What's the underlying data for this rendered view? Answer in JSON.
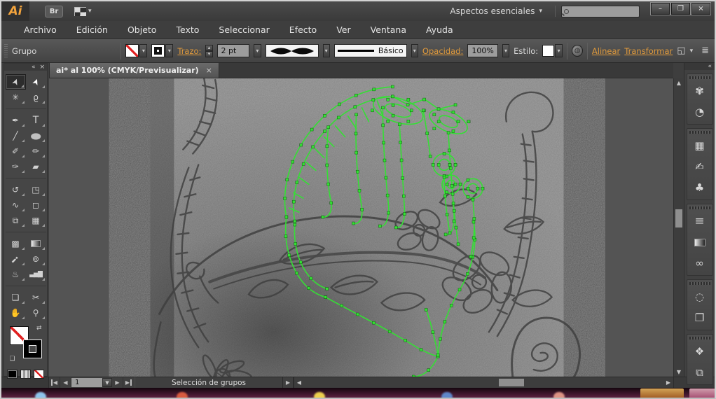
{
  "window": {
    "app_initials": "Ai",
    "bridge_label": "Br",
    "workspace_switcher": "Aspectos esenciales",
    "search_value": ""
  },
  "menus": [
    "Archivo",
    "Edición",
    "Objeto",
    "Texto",
    "Seleccionar",
    "Efecto",
    "Ver",
    "Ventana",
    "Ayuda"
  ],
  "control_bar": {
    "selection_label": "Grupo",
    "stroke_link": "Trazo:",
    "stroke_width_value": "2 pt",
    "brush_definition": "Básico",
    "opacity_link": "Opacidad:",
    "opacity_value": "100%",
    "style_label": "Estilo:",
    "align_link": "Alinear",
    "transform_link": "Transformar"
  },
  "tab": {
    "title": "ai* al 100% (CMYK/Previsualizar)",
    "close": "×"
  },
  "tools_panel": {
    "collapse": "«",
    "close": "×"
  },
  "tools": [
    {
      "name": "selection-tool",
      "glyph": "➤",
      "active": true
    },
    {
      "name": "direct-selection-tool",
      "glyph": "➤",
      "active": false
    },
    {
      "name": "magic-wand-tool",
      "glyph": "✳",
      "active": false
    },
    {
      "name": "lasso-tool",
      "glyph": "ϱ",
      "active": false
    },
    {
      "name": "pen-tool",
      "glyph": "✒",
      "active": false
    },
    {
      "name": "type-tool",
      "glyph": "T",
      "active": false
    },
    {
      "name": "line-segment-tool",
      "glyph": "╱",
      "active": false
    },
    {
      "name": "ellipse-tool",
      "glyph": "●",
      "active": false
    },
    {
      "name": "paintbrush-tool",
      "glyph": "✐",
      "active": false
    },
    {
      "name": "pencil-tool",
      "glyph": "✏",
      "active": false
    },
    {
      "name": "blob-brush-tool",
      "glyph": "✑",
      "active": false
    },
    {
      "name": "eraser-tool",
      "glyph": "▰",
      "active": false
    },
    {
      "name": "rotate-tool",
      "glyph": "↺",
      "active": false
    },
    {
      "name": "scale-tool",
      "glyph": "◳",
      "active": false
    },
    {
      "name": "width-tool",
      "glyph": "∿",
      "active": false
    },
    {
      "name": "free-transform-tool",
      "glyph": "◻",
      "active": false
    },
    {
      "name": "shape-builder-tool",
      "glyph": "⧉",
      "active": false
    },
    {
      "name": "perspective-grid-tool",
      "glyph": "▦",
      "active": false
    },
    {
      "name": "mesh-tool",
      "glyph": "▩",
      "active": false
    },
    {
      "name": "gradient-tool",
      "glyph": "",
      "active": false
    },
    {
      "name": "eyedropper-tool",
      "glyph": "¡",
      "active": false
    },
    {
      "name": "blend-tool",
      "glyph": "⊚",
      "active": false
    },
    {
      "name": "symbol-sprayer-tool",
      "glyph": "♨",
      "active": false
    },
    {
      "name": "column-graph-tool",
      "glyph": "▃▅▇",
      "active": false
    },
    {
      "name": "artboard-tool",
      "glyph": "❏",
      "active": false
    },
    {
      "name": "slice-tool",
      "glyph": "✂",
      "active": false
    },
    {
      "name": "hand-tool",
      "glyph": "✋",
      "active": false
    },
    {
      "name": "zoom-tool",
      "glyph": "⚲",
      "active": false
    }
  ],
  "right_dock": {
    "collapse": "«",
    "items": [
      {
        "name": "color-panel-icon",
        "glyph": "✾"
      },
      {
        "name": "color-guide-panel-icon",
        "glyph": "◔"
      },
      {
        "name": "swatches-panel-icon",
        "glyph": "▦"
      },
      {
        "name": "brushes-panel-icon",
        "glyph": "✍"
      },
      {
        "name": "symbols-panel-icon",
        "glyph": "♣"
      },
      {
        "name": "stroke-panel-icon",
        "glyph": "≡"
      },
      {
        "name": "gradient-panel-icon",
        "glyph": ""
      },
      {
        "name": "transparency-panel-icon",
        "glyph": "∞"
      },
      {
        "name": "appearance-panel-icon",
        "glyph": "◌"
      },
      {
        "name": "graphic-styles-panel-icon",
        "glyph": "❐"
      },
      {
        "name": "layers-panel-icon",
        "glyph": "❖"
      },
      {
        "name": "artboards-panel-icon",
        "glyph": "⧉"
      }
    ]
  },
  "status_bar": {
    "artboard_number": "1",
    "status_text": "Selección de grupos"
  },
  "icons": {
    "dropdown": "▾",
    "step_up": "▴",
    "step_down": "▾",
    "scroll_up": "▲",
    "scroll_down": "▼",
    "scroll_left": "◀",
    "scroll_right": "▶",
    "nav_first": "◀",
    "nav_prev": "◀",
    "nav_next": "▶",
    "nav_last": "▶",
    "expand_status": "▶",
    "swap_arrows": "⇄",
    "default_swatches": "❏",
    "recolor": "◍",
    "select_similar": "◱",
    "panel_options": "≣",
    "minimize": "–",
    "restore": "❐",
    "close": "×"
  },
  "colors": {
    "accent_orange": "#e09a3c",
    "vector_green": "#35df35",
    "pasteboard": "#545454",
    "photo_gray": "#818181"
  }
}
